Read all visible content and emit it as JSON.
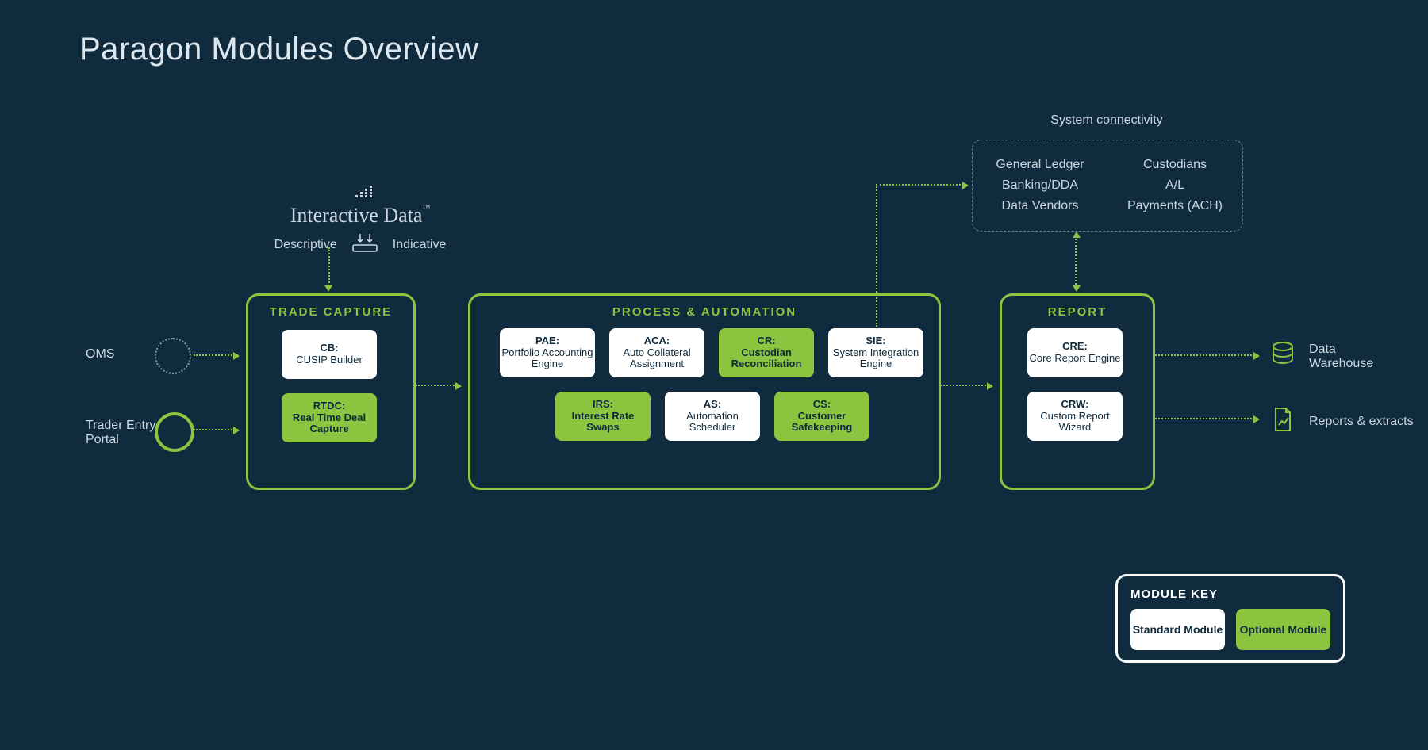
{
  "title": "Paragon Modules Overview",
  "interactive_data": {
    "brand": "Interactive Data",
    "left": "Descriptive",
    "right": "Indicative"
  },
  "inputs": {
    "oms": "OMS",
    "tep": "Trader Entry Portal"
  },
  "stages": {
    "trade": {
      "title": "TRADE CAPTURE"
    },
    "proc": {
      "title": "PROCESS & AUTOMATION"
    },
    "report": {
      "title": "REPORT"
    }
  },
  "modules": {
    "cb": {
      "code": "CB:",
      "name": "CUSIP Builder",
      "type": "std"
    },
    "rtdc": {
      "code": "RTDC:",
      "name": "Real Time Deal Capture",
      "type": "opt"
    },
    "pae": {
      "code": "PAE:",
      "name": "Portfolio Accounting Engine",
      "type": "std"
    },
    "aca": {
      "code": "ACA:",
      "name": "Auto Collateral Assignment",
      "type": "std"
    },
    "cr": {
      "code": "CR:",
      "name": "Custodian Reconciliation",
      "type": "opt"
    },
    "sie": {
      "code": "SIE:",
      "name": "System Integration Engine",
      "type": "std"
    },
    "irs": {
      "code": "IRS:",
      "name": "Interest Rate Swaps",
      "type": "opt"
    },
    "as": {
      "code": "AS:",
      "name": "Automation Scheduler",
      "type": "std"
    },
    "cs": {
      "code": "CS:",
      "name": "Customer Safekeeping",
      "type": "opt"
    },
    "cre": {
      "code": "CRE:",
      "name": "Core Report Engine",
      "type": "std"
    },
    "crw": {
      "code": "CRW:",
      "name": "Custom Report Wizard",
      "type": "std"
    }
  },
  "connectivity": {
    "label": "System connectivity",
    "left": [
      "General Ledger",
      "Banking/DDA",
      "Data Vendors"
    ],
    "right": [
      "Custodians",
      "A/L",
      "Payments (ACH)"
    ]
  },
  "outputs": {
    "dw": "Data Warehouse",
    "rep": "Reports & extracts"
  },
  "key": {
    "title": "MODULE KEY",
    "std": "Standard Module",
    "opt": "Optional Module"
  }
}
